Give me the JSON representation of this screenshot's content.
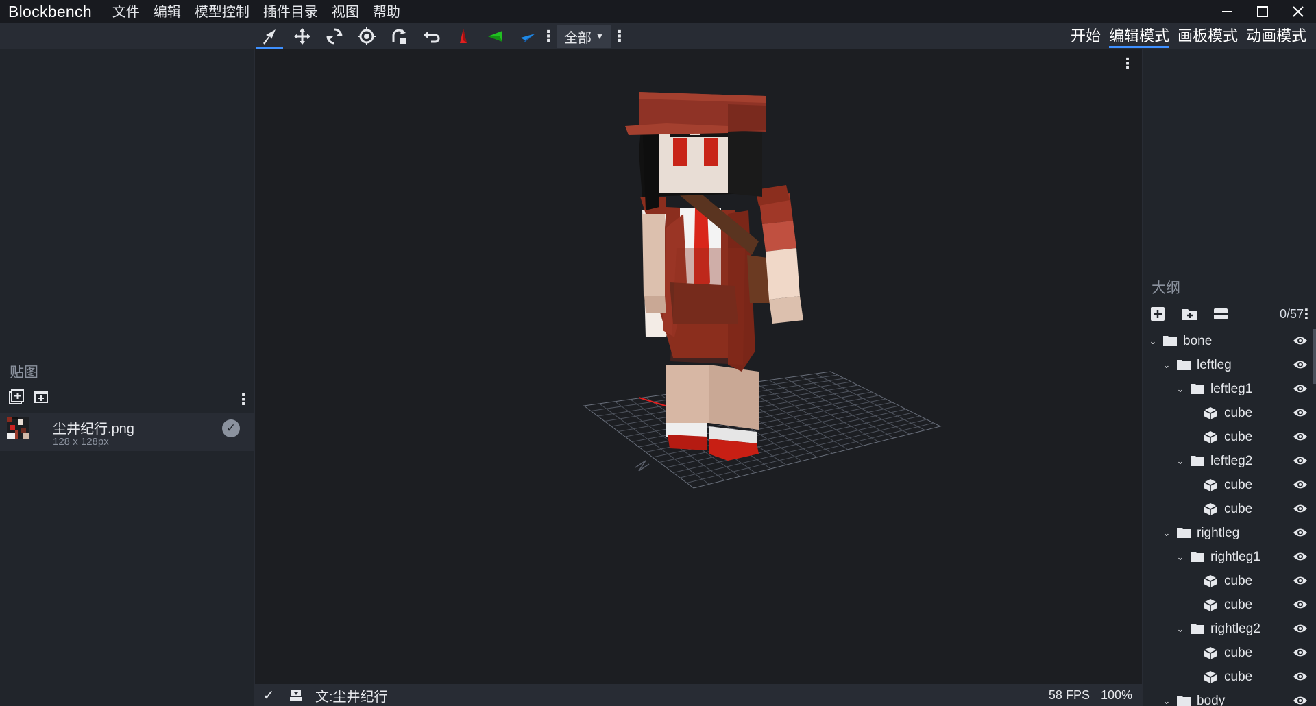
{
  "app": {
    "title": "Blockbench",
    "menu": [
      "文件",
      "编辑",
      "模型控制",
      "插件目录",
      "视图",
      "帮助"
    ]
  },
  "window_controls": [
    "minimize-icon",
    "maximize-icon",
    "close-icon"
  ],
  "toolbar": {
    "tools": [
      "move-tool-icon",
      "move-icon",
      "rotate-icon",
      "pivot-icon",
      "resize-icon",
      "undo-icon",
      "axis-x-icon",
      "axis-y-icon",
      "axis-z-icon"
    ],
    "select_all": "全部"
  },
  "modes": [
    "开始",
    "编辑模式",
    "画板模式",
    "动画模式"
  ],
  "active_mode": "编辑模式",
  "textures_panel": {
    "title": "贴图",
    "items": [
      {
        "name": "尘井纪行.png",
        "size": "128 x 128px"
      }
    ]
  },
  "outliner": {
    "title": "大纲",
    "count": "0/57",
    "nodes": [
      {
        "label": "bone",
        "type": "group",
        "depth": 0
      },
      {
        "label": "leftleg",
        "type": "group",
        "depth": 1
      },
      {
        "label": "leftleg1",
        "type": "group",
        "depth": 2
      },
      {
        "label": "cube",
        "type": "cube",
        "depth": 3
      },
      {
        "label": "cube",
        "type": "cube",
        "depth": 3
      },
      {
        "label": "leftleg2",
        "type": "group",
        "depth": 2
      },
      {
        "label": "cube",
        "type": "cube",
        "depth": 3
      },
      {
        "label": "cube",
        "type": "cube",
        "depth": 3
      },
      {
        "label": "rightleg",
        "type": "group",
        "depth": 1
      },
      {
        "label": "rightleg1",
        "type": "group",
        "depth": 2
      },
      {
        "label": "cube",
        "type": "cube",
        "depth": 3
      },
      {
        "label": "cube",
        "type": "cube",
        "depth": 3
      },
      {
        "label": "rightleg2",
        "type": "group",
        "depth": 2
      },
      {
        "label": "cube",
        "type": "cube",
        "depth": 3
      },
      {
        "label": "cube",
        "type": "cube",
        "depth": 3
      },
      {
        "label": "body",
        "type": "group",
        "depth": 1
      }
    ]
  },
  "status": {
    "project": "文:尘井纪行",
    "fps": "58 FPS",
    "zoom": "100%"
  },
  "colors": {
    "accent": "#3e90ff",
    "axis_x": "#e02020",
    "axis_y": "#22c022",
    "axis_z": "#1e88e5"
  }
}
